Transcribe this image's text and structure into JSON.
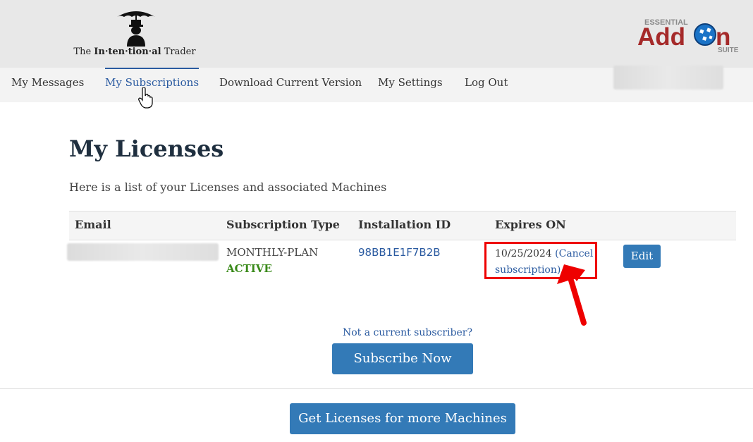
{
  "header": {
    "logo_prefix": "The ",
    "logo_bold": "In·ten·tion·al",
    "logo_suffix": " Trader",
    "addon_logo": {
      "top": "ESSENTIAL",
      "main_a": "Add",
      "main_b": "n",
      "bottom": "SUITE",
      "accent_color": "#a52a2a",
      "globe_color": "#1a73c7"
    }
  },
  "nav": {
    "items": [
      {
        "label": "My Messages",
        "active": false
      },
      {
        "label": "My Subscriptions",
        "active": true
      },
      {
        "label": "Download Current Version",
        "active": false
      },
      {
        "label": "My Settings",
        "active": false
      },
      {
        "label": "Log Out",
        "active": false
      }
    ],
    "active_color": "#2a5aa0"
  },
  "main": {
    "title": "My Licenses",
    "subtitle": "Here is a list of your Licenses and associated Machines",
    "table": {
      "headers": [
        "Email",
        "Subscription Type",
        "Installation ID",
        "Expires ON"
      ],
      "rows": [
        {
          "plan": "MONTHLY-PLAN",
          "status": "ACTIVE",
          "installation_id": "98BB1E1F7B2B",
          "expires_date": "10/25/2024",
          "cancel_open": "(Cancel",
          "cancel_close": "subscription)",
          "edit_label": "Edit"
        }
      ]
    },
    "not_subscriber": "Not a current subscriber?",
    "subscribe_label": "Subscribe Now",
    "more_machines_label": "Get Licenses for more Machines"
  },
  "colors": {
    "button": "#337ab7",
    "highlight": "#e00000",
    "status_active": "#3a8a1a"
  }
}
